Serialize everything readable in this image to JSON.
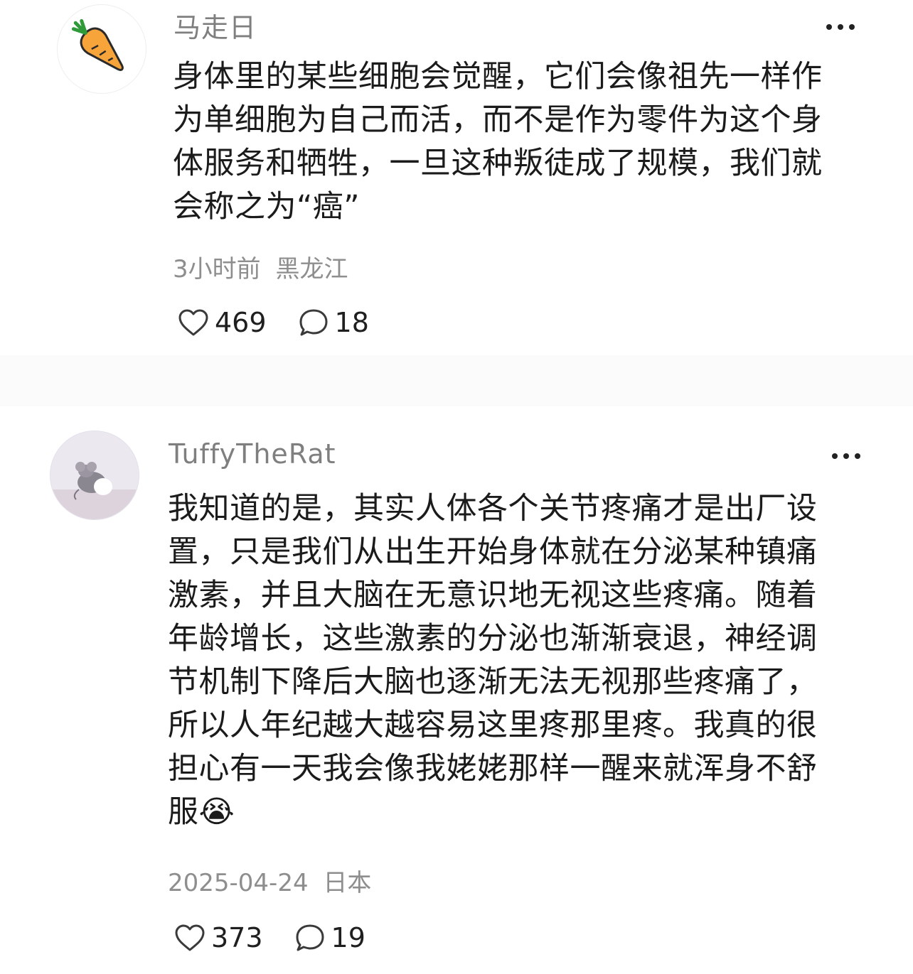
{
  "comments": [
    {
      "username": "马走日",
      "avatar_icon": "carrot-icon",
      "content_lines": [
        "身体里的某些细胞会觉醒，它们会像祖先一样作",
        "为单细胞为自己而活，而不是作为零件为这个身",
        "体服务和牺牲，一旦这种叛徒成了规模，我们就",
        "会称之为“癌”"
      ],
      "time": "3小时前",
      "location": "黑龙江",
      "likes": "469",
      "replies": "18"
    },
    {
      "username": "TuffyTheRat",
      "avatar_icon": "tuffy-mouse-icon",
      "content_lines": [
        "我知道的是，其实人体各个关节疼痛才是出厂设",
        "置，只是我们从出生开始身体就在分泌某种镇痛",
        "激素，并且大脑在无意识地无视这些疼痛。随着",
        "年龄增长，这些激素的分泌也渐渐衰退，神经调",
        "节机制下降后大脑也逐渐无法无视那些疼痛了，",
        "所以人年纪越大越容易这里疼那里疼。我真的很",
        "担心有一天我会像我姥姥那样一醒来就浑身不舒",
        "服😭"
      ],
      "time": "2025-04-24",
      "location": "日本",
      "likes": "373",
      "replies": "19"
    }
  ],
  "icons": {
    "like": "heart-outline-icon",
    "reply": "speech-bubble-icon",
    "more": "more-dots-icon"
  }
}
